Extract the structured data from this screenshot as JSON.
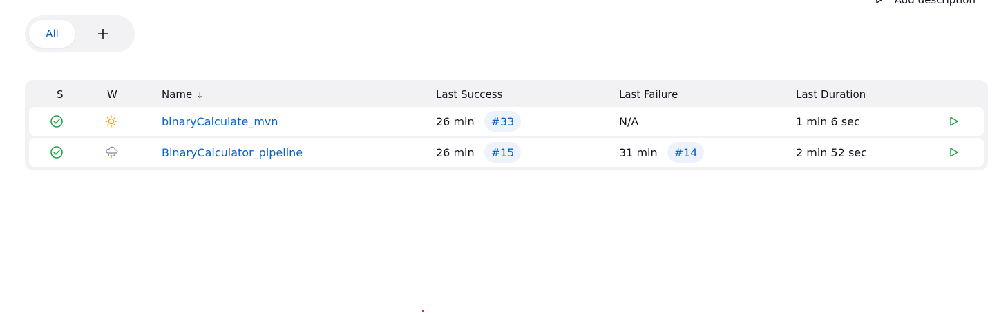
{
  "header": {
    "add_description_label": "Add description"
  },
  "tabs": [
    {
      "label": "All"
    }
  ],
  "table": {
    "columns": {
      "status": "S",
      "weather": "W",
      "name": "Name",
      "name_sort": "↓",
      "last_success": "Last Success",
      "last_failure": "Last Failure",
      "last_duration": "Last Duration"
    },
    "rows": [
      {
        "name": "binaryCalculate_mvn",
        "status_icon": "success-check-icon",
        "weather_icon": "sunny-icon",
        "last_success": "26 min",
        "last_success_build": "#33",
        "last_failure": "N/A",
        "last_failure_build": "",
        "last_duration": "1 min 6 sec"
      },
      {
        "name": "BinaryCalculator_pipeline",
        "status_icon": "success-check-icon",
        "weather_icon": "storm-icon",
        "last_success": "26 min",
        "last_success_build": "#15",
        "last_failure": "31 min",
        "last_failure_build": "#14",
        "last_duration": "2 min 52 sec"
      }
    ]
  },
  "colors": {
    "accent": "#0b62c9",
    "success": "#1ea446",
    "panel": "#f2f2f5",
    "badge_bg": "#eef3fb"
  }
}
